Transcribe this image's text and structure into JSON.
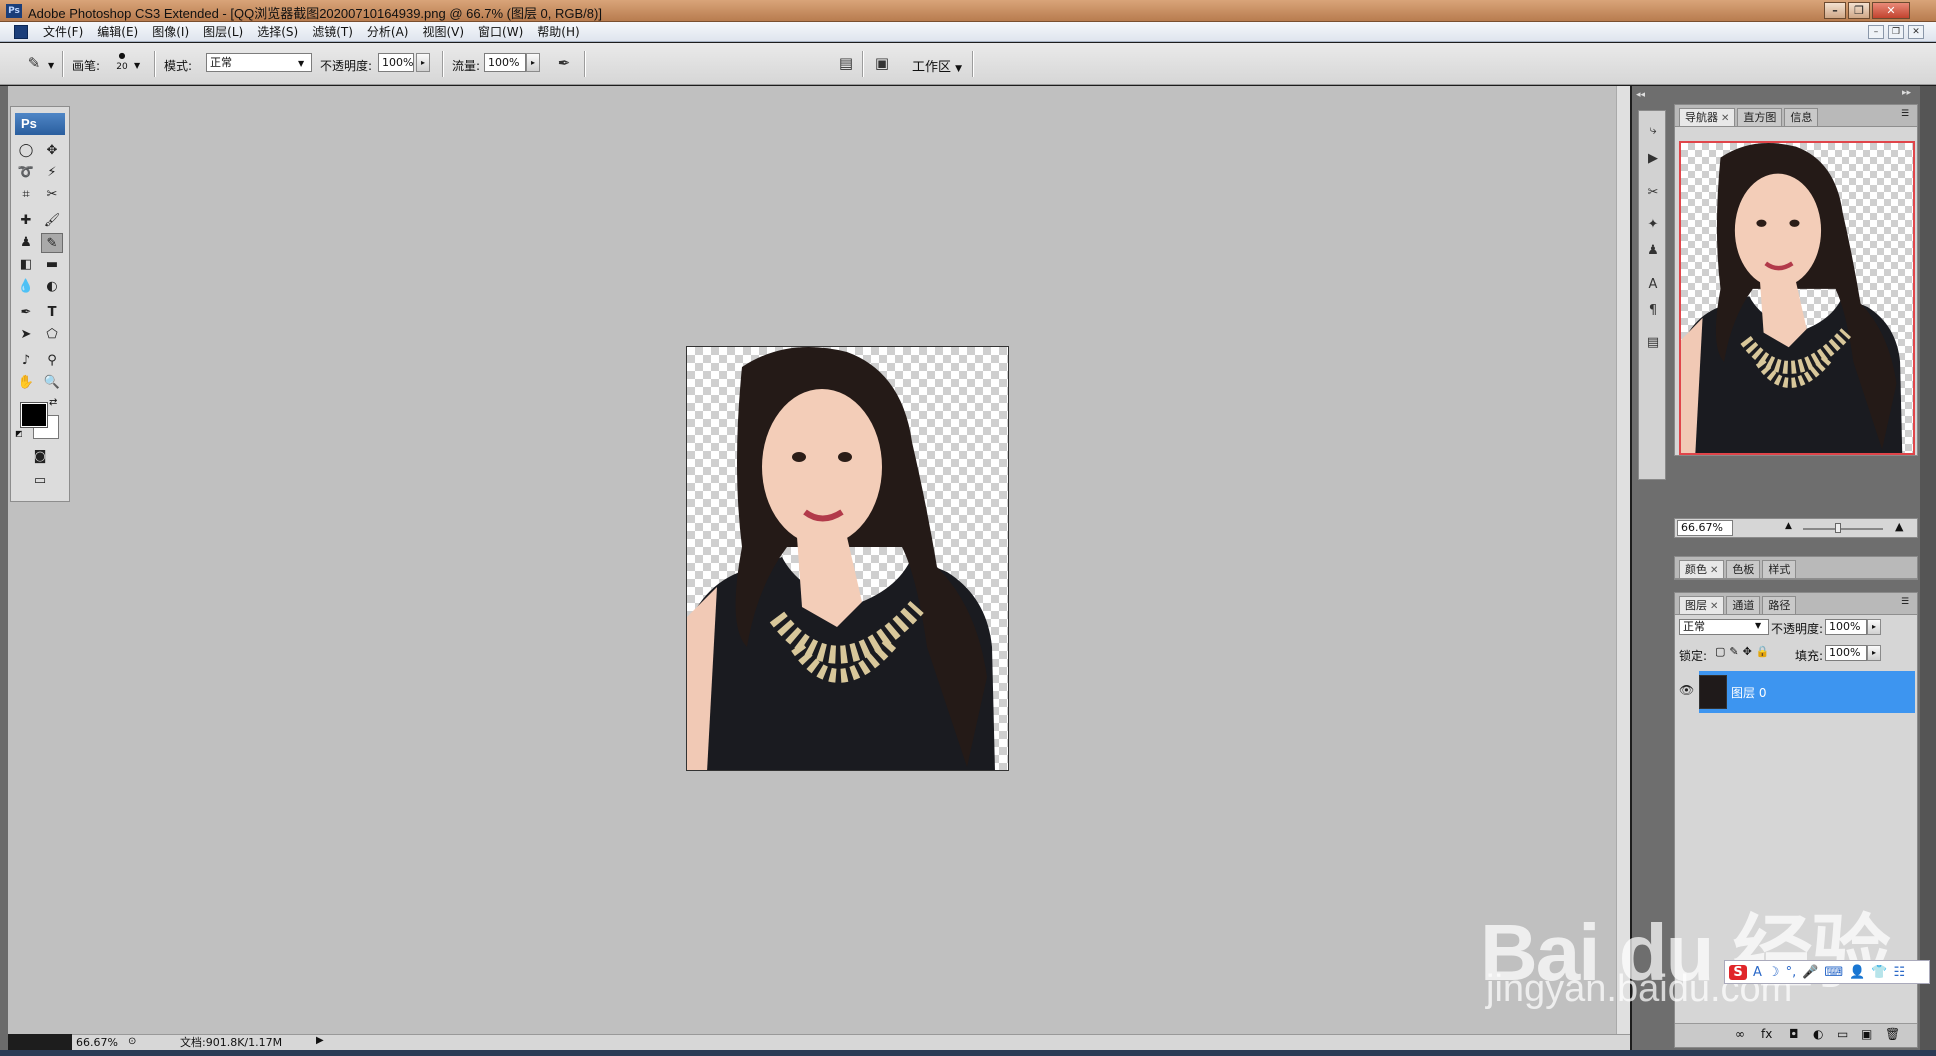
{
  "window": {
    "title": "Adobe Photoshop CS3 Extended - [QQ浏览器截图20200710164939.png @ 66.7% (图层 0, RGB/8)]",
    "app_logo": "Ps"
  },
  "menu": {
    "items": [
      "文件(F)",
      "编辑(E)",
      "图像(I)",
      "图层(L)",
      "选择(S)",
      "滤镜(T)",
      "分析(A)",
      "视图(V)",
      "窗口(W)",
      "帮助(H)"
    ]
  },
  "options": {
    "brush_label": "画笔:",
    "brush_size": "20",
    "mode_label": "模式:",
    "mode_value": "正常",
    "opacity_label": "不透明度:",
    "opacity_value": "100%",
    "flow_label": "流量:",
    "flow_value": "100%",
    "workspace_label": "工作区"
  },
  "toolbox": {
    "header": "Ps"
  },
  "status": {
    "zoom": "66.67%",
    "doc_info": "文档:901.8K/1.17M"
  },
  "navigator": {
    "tabs": [
      {
        "label": "导航器",
        "closable": true
      },
      {
        "label": "直方图",
        "closable": false
      },
      {
        "label": "信息",
        "closable": false
      }
    ],
    "zoom": "66.67%"
  },
  "color_panel": {
    "tabs": [
      {
        "label": "颜色",
        "closable": true
      },
      {
        "label": "色板",
        "closable": false
      },
      {
        "label": "样式",
        "closable": false
      }
    ]
  },
  "layers": {
    "tabs": [
      {
        "label": "图层",
        "closable": true
      },
      {
        "label": "通道",
        "closable": false
      },
      {
        "label": "路径",
        "closable": false
      }
    ],
    "blend_mode": "正常",
    "opacity_label": "不透明度:",
    "opacity_value": "100%",
    "lock_label": "锁定:",
    "fill_label": "填充:",
    "fill_value": "100%",
    "items": [
      {
        "name": "图层 0",
        "selected": true,
        "visible": true
      }
    ]
  },
  "watermark": {
    "brand": "Bai du 经验",
    "url": "jingyan.baidu.com"
  },
  "colors": {
    "accent": "#3d95f0",
    "workspace": "#c0c0c0",
    "nav_frame": "#e0454a",
    "foreground": "#000000",
    "background": "#ffffff"
  }
}
